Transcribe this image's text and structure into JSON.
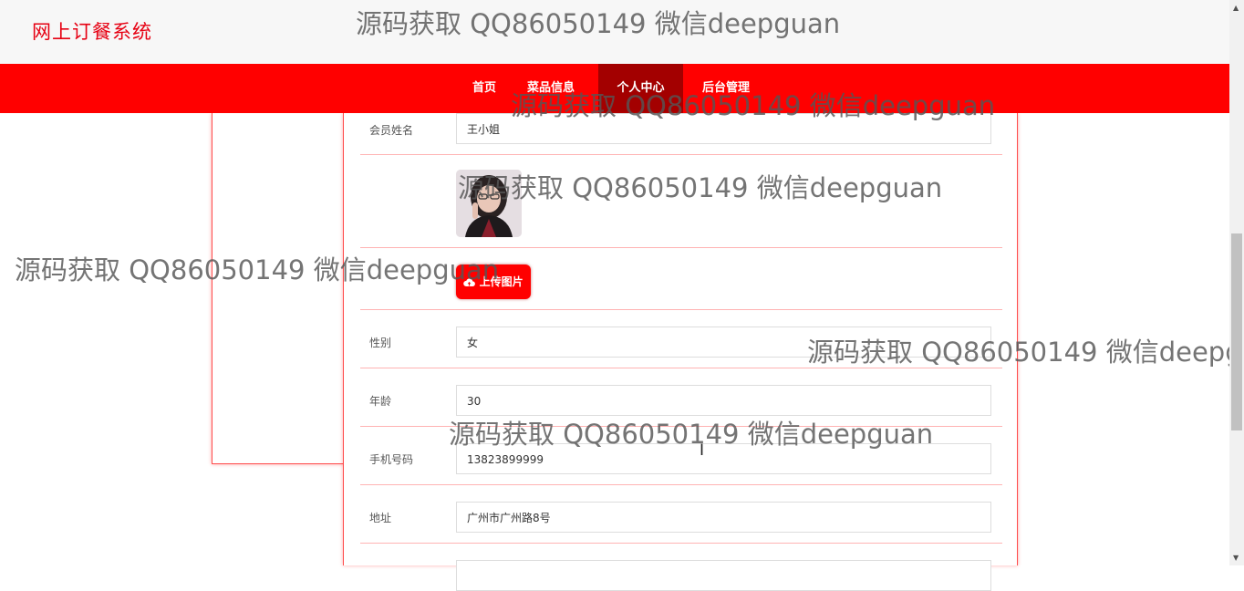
{
  "header": {
    "brand": "网上订餐系统"
  },
  "nav": {
    "items": [
      {
        "label": "首页"
      },
      {
        "label": "菜品信息"
      },
      {
        "label": "个人中心"
      },
      {
        "label": "后台管理"
      }
    ],
    "active": "个人中心"
  },
  "form": {
    "name": {
      "label": "会员姓名",
      "value": "王小姐"
    },
    "upload": {
      "label": "上传图片"
    },
    "gender": {
      "label": "性别",
      "value": "女"
    },
    "age": {
      "label": "年龄",
      "value": "30"
    },
    "phone": {
      "label": "手机号码",
      "value": "13823899999"
    },
    "address": {
      "label": "地址",
      "value": "广州市广州路8号"
    }
  },
  "watermark": "源码获取 QQ86050149 微信deepguan",
  "colors": {
    "brand": "#e60012",
    "nav_bg": "#ff0000",
    "nav_active": "#a30000"
  }
}
